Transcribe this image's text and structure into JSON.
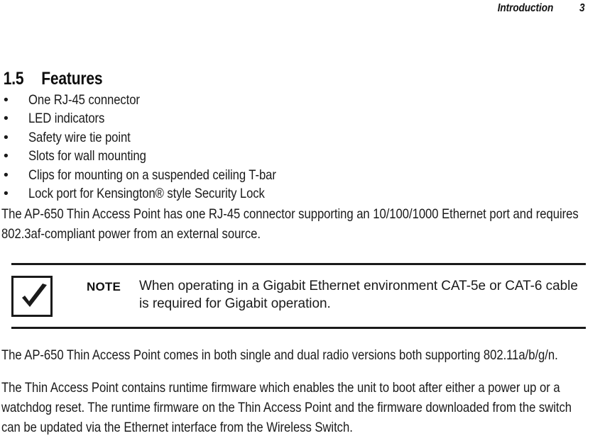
{
  "header": {
    "chapter": "Introduction",
    "page_number": "3"
  },
  "section": {
    "number": "1.5",
    "title": "Features"
  },
  "features": [
    {
      "bullet": "•",
      "text": "One RJ-45 connector"
    },
    {
      "bullet": "•",
      "text": "LED indicators"
    },
    {
      "bullet": "•",
      "text": "Safety wire tie point"
    },
    {
      "bullet": "•",
      "text": "Slots for wall mounting"
    },
    {
      "bullet": "•",
      "text": "Clips for mounting on a suspended ceiling T-bar"
    },
    {
      "bullet": "•",
      "text": "Lock port for Kensington® style Security Lock"
    }
  ],
  "paragraphs": {
    "after_list": "The AP-650 Thin Access Point has one RJ-45 connector supporting an 10/100/1000 Ethernet port and requires 802.3af-compliant power from an external source.",
    "lower_first": "The AP-650 Thin Access Point comes in both single and dual radio versions both supporting 802.11a/b/g/n.",
    "lower_second": "The Thin Access Point contains runtime firmware which enables the unit to boot after either a power up or a watchdog reset. The runtime firmware on the Thin Access Point and the firmware downloaded from the switch can be updated via the Ethernet interface from the Wireless Switch."
  },
  "note": {
    "icon_name": "checkmark-box-icon",
    "label": "NOTE",
    "text": "When operating in a Gigabit Ethernet environment CAT-5e or CAT-6 cable\nis required for Gigabit operation."
  },
  "colors": {
    "text": "#1a1a1a",
    "rule": "#1a1a1a",
    "background": "#ffffff"
  }
}
